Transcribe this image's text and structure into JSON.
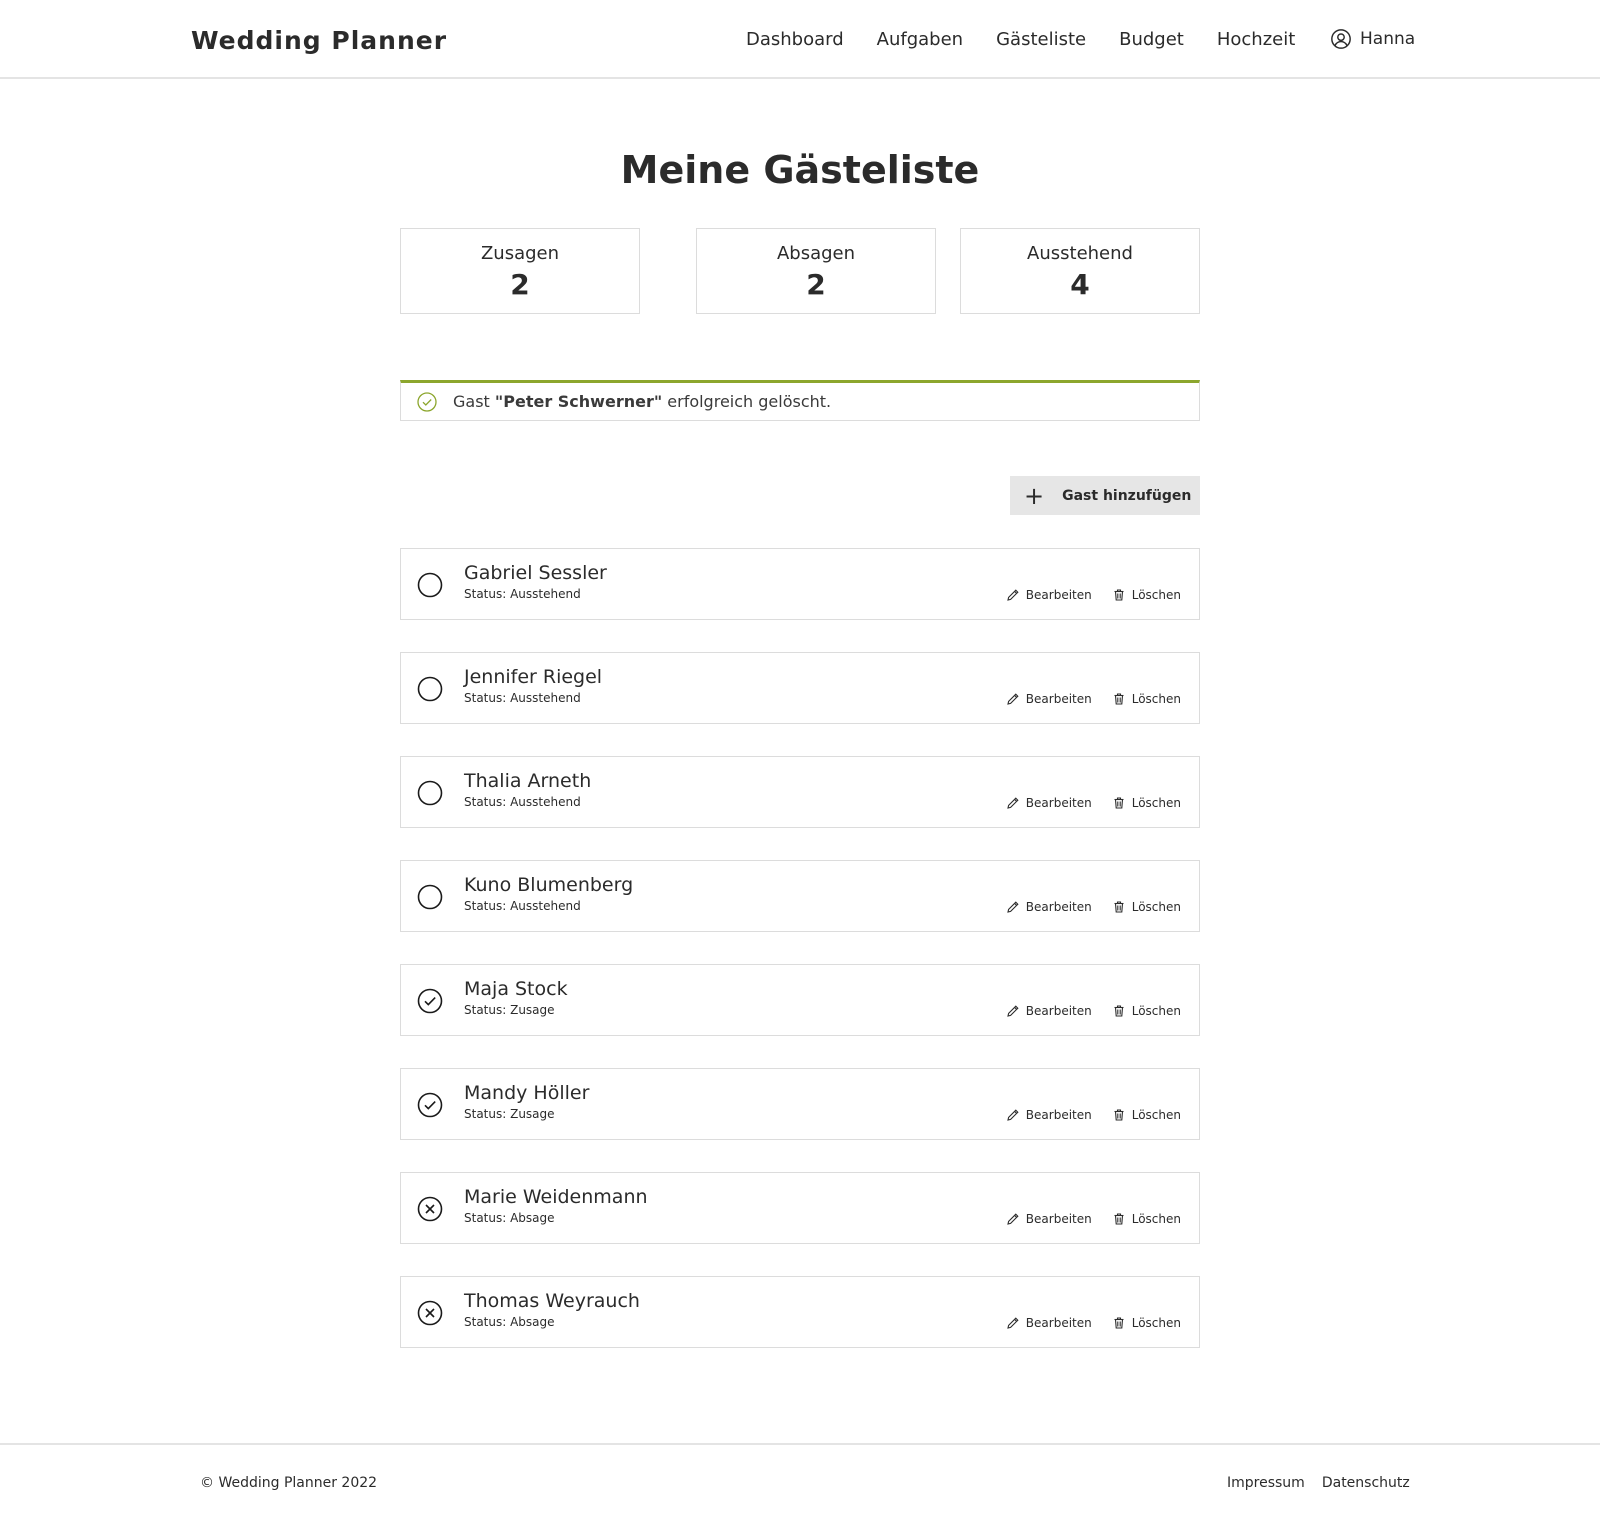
{
  "header": {
    "brand": "Wedding Planner",
    "nav": [
      "Dashboard",
      "Aufgaben",
      "Gästeliste",
      "Budget",
      "Hochzeit"
    ],
    "user_name": "Hanna"
  },
  "page_title": "Meine Gästeliste",
  "stats": [
    {
      "label": "Zusagen",
      "value": "2"
    },
    {
      "label": "Absagen",
      "value": "2"
    },
    {
      "label": "Ausstehend",
      "value": "4"
    }
  ],
  "alert": {
    "prefix": "Gast",
    "name": "\"Peter Schwerner\"",
    "suffix": "erfolgreich gelöscht.",
    "color": "#8ca62d"
  },
  "add_button_label": "Gast hinzufügen",
  "actions": {
    "edit": "Bearbeiten",
    "delete": "Löschen"
  },
  "guests": [
    {
      "name": "Gabriel Sessler",
      "status": "Status: Ausstehend",
      "icon": "circle-empty-icon"
    },
    {
      "name": "Jennifer Riegel",
      "status": "Status: Ausstehend",
      "icon": "circle-empty-icon"
    },
    {
      "name": "Thalia Arneth",
      "status": "Status: Ausstehend",
      "icon": "circle-empty-icon"
    },
    {
      "name": "Kuno Blumenberg",
      "status": "Status: Ausstehend",
      "icon": "circle-empty-icon"
    },
    {
      "name": "Maja Stock",
      "status": "Status: Zusage",
      "icon": "circle-check-icon"
    },
    {
      "name": "Mandy Höller",
      "status": "Status: Zusage",
      "icon": "circle-check-icon"
    },
    {
      "name": "Marie Weidenmann",
      "status": "Status: Absage",
      "icon": "circle-x-icon"
    },
    {
      "name": "Thomas Weyrauch",
      "status": "Status: Absage",
      "icon": "circle-x-icon"
    }
  ],
  "footer": {
    "copyright": "© Wedding Planner 2022",
    "links": [
      "Impressum",
      "Datenschutz"
    ]
  }
}
